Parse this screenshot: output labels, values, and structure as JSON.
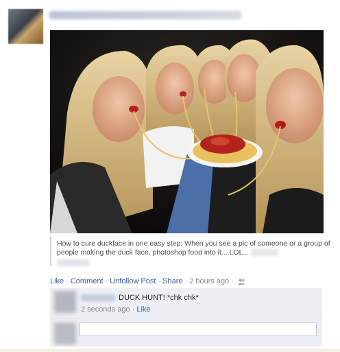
{
  "post": {
    "caption": "How to cure duckface in one easy step: When you see a pic of someone or a group of people making the duck face, photoshop food into it....LOL...",
    "actions": {
      "like": "Like",
      "comment": "Comment",
      "unfollow": "Unfollow Post",
      "share": "Share",
      "time": "2 hours ago",
      "audience_icon": "people-icon"
    }
  },
  "comments": [
    {
      "text": "DUCK HUNT! *chk chk*",
      "time": "2 seconds ago",
      "like": "Like"
    }
  ],
  "reply": {
    "placeholder": ""
  },
  "colors": {
    "link": "#3b5998",
    "comment_bg": "#edeff4"
  }
}
